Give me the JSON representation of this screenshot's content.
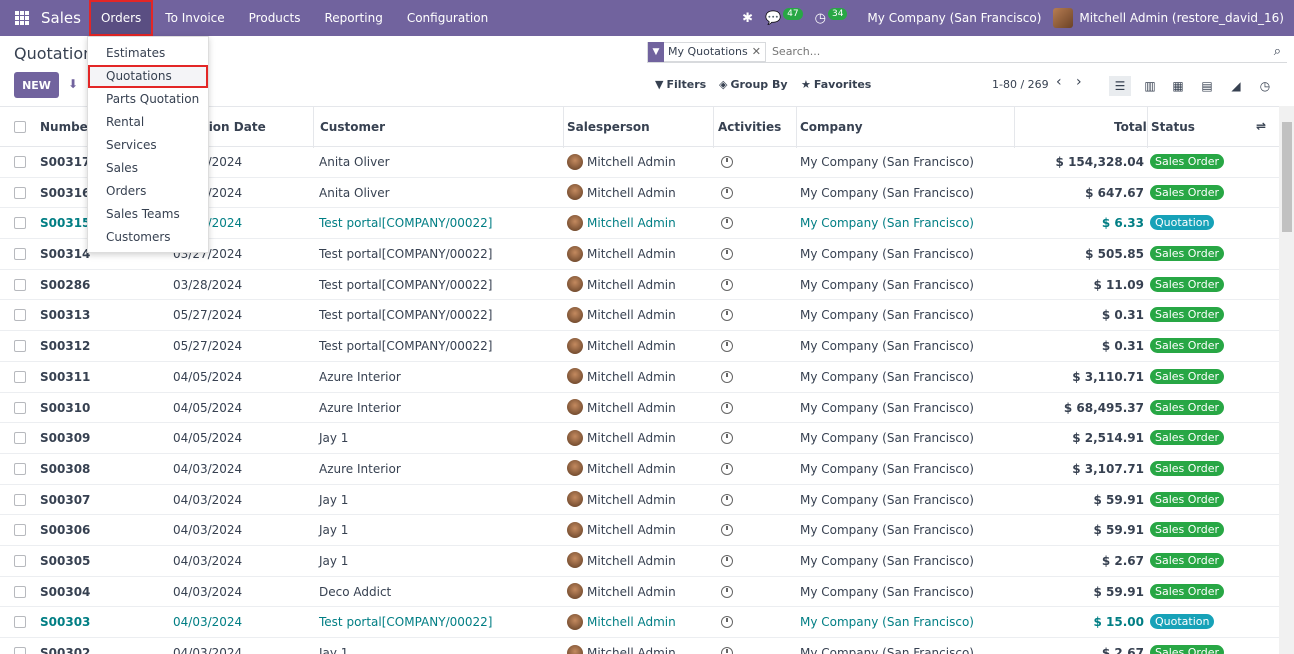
{
  "navbar": {
    "brand": "Sales",
    "menu": [
      "Orders",
      "To Invoice",
      "Products",
      "Reporting",
      "Configuration"
    ],
    "messages_count": "47",
    "activities_count": "34",
    "company": "My Company (San Francisco)",
    "user": "Mitchell Admin (restore_david_16)"
  },
  "dropdown": {
    "items": [
      "Estimates",
      "Quotations",
      "Parts Quotation",
      "Rental",
      "Services",
      "Sales",
      "Orders",
      "Sales Teams",
      "Customers"
    ]
  },
  "control": {
    "title": "Quotations",
    "new_label": "NEW",
    "facet": "My Quotations",
    "search_placeholder": "Search...",
    "filters": "Filters",
    "group_by": "Group By",
    "favorites": "Favorites",
    "pager": "1-80 / 269"
  },
  "table": {
    "headers": {
      "number": "Number",
      "date": "Creation Date",
      "customer": "Customer",
      "salesperson": "Salesperson",
      "activities": "Activities",
      "company": "Company",
      "total": "Total",
      "status": "Status"
    },
    "rows": [
      {
        "number": "S00317",
        "date": "03/27/2024",
        "customer": "Anita Oliver",
        "salesperson": "Mitchell Admin",
        "company": "My Company (San Francisco)",
        "total": "$ 154,328.04",
        "status": "Sales Order",
        "quote": false
      },
      {
        "number": "S00316",
        "date": "03/27/2024",
        "customer": "Anita Oliver",
        "salesperson": "Mitchell Admin",
        "company": "My Company (San Francisco)",
        "total": "$ 647.67",
        "status": "Sales Order",
        "quote": false
      },
      {
        "number": "S00315",
        "date": "03/27/2024",
        "customer": "Test portal[COMPANY/00022]",
        "salesperson": "Mitchell Admin",
        "company": "My Company (San Francisco)",
        "total": "$ 6.33",
        "status": "Quotation",
        "quote": true
      },
      {
        "number": "S00314",
        "date": "03/27/2024",
        "customer": "Test portal[COMPANY/00022]",
        "salesperson": "Mitchell Admin",
        "company": "My Company (San Francisco)",
        "total": "$ 505.85",
        "status": "Sales Order",
        "quote": false
      },
      {
        "number": "S00286",
        "date": "03/28/2024",
        "customer": "Test portal[COMPANY/00022]",
        "salesperson": "Mitchell Admin",
        "company": "My Company (San Francisco)",
        "total": "$ 11.09",
        "status": "Sales Order",
        "quote": false
      },
      {
        "number": "S00313",
        "date": "05/27/2024",
        "customer": "Test portal[COMPANY/00022]",
        "salesperson": "Mitchell Admin",
        "company": "My Company (San Francisco)",
        "total": "$ 0.31",
        "status": "Sales Order",
        "quote": false
      },
      {
        "number": "S00312",
        "date": "05/27/2024",
        "customer": "Test portal[COMPANY/00022]",
        "salesperson": "Mitchell Admin",
        "company": "My Company (San Francisco)",
        "total": "$ 0.31",
        "status": "Sales Order",
        "quote": false
      },
      {
        "number": "S00311",
        "date": "04/05/2024",
        "customer": "Azure Interior",
        "salesperson": "Mitchell Admin",
        "company": "My Company (San Francisco)",
        "total": "$ 3,110.71",
        "status": "Sales Order",
        "quote": false
      },
      {
        "number": "S00310",
        "date": "04/05/2024",
        "customer": "Azure Interior",
        "salesperson": "Mitchell Admin",
        "company": "My Company (San Francisco)",
        "total": "$ 68,495.37",
        "status": "Sales Order",
        "quote": false
      },
      {
        "number": "S00309",
        "date": "04/05/2024",
        "customer": "Jay 1",
        "salesperson": "Mitchell Admin",
        "company": "My Company (San Francisco)",
        "total": "$ 2,514.91",
        "status": "Sales Order",
        "quote": false
      },
      {
        "number": "S00308",
        "date": "04/03/2024",
        "customer": "Azure Interior",
        "salesperson": "Mitchell Admin",
        "company": "My Company (San Francisco)",
        "total": "$ 3,107.71",
        "status": "Sales Order",
        "quote": false
      },
      {
        "number": "S00307",
        "date": "04/03/2024",
        "customer": "Jay 1",
        "salesperson": "Mitchell Admin",
        "company": "My Company (San Francisco)",
        "total": "$ 59.91",
        "status": "Sales Order",
        "quote": false
      },
      {
        "number": "S00306",
        "date": "04/03/2024",
        "customer": "Jay 1",
        "salesperson": "Mitchell Admin",
        "company": "My Company (San Francisco)",
        "total": "$ 59.91",
        "status": "Sales Order",
        "quote": false
      },
      {
        "number": "S00305",
        "date": "04/03/2024",
        "customer": "Jay 1",
        "salesperson": "Mitchell Admin",
        "company": "My Company (San Francisco)",
        "total": "$ 2.67",
        "status": "Sales Order",
        "quote": false
      },
      {
        "number": "S00304",
        "date": "04/03/2024",
        "customer": "Deco Addict",
        "salesperson": "Mitchell Admin",
        "company": "My Company (San Francisco)",
        "total": "$ 59.91",
        "status": "Sales Order",
        "quote": false
      },
      {
        "number": "S00303",
        "date": "04/03/2024",
        "customer": "Test portal[COMPANY/00022]",
        "salesperson": "Mitchell Admin",
        "company": "My Company (San Francisco)",
        "total": "$ 15.00",
        "status": "Quotation",
        "quote": true
      },
      {
        "number": "S00302",
        "date": "04/03/2024",
        "customer": "Jay 1",
        "salesperson": "Mitchell Admin",
        "company": "My Company (San Francisco)",
        "total": "$ 2.67",
        "status": "Sales Order",
        "quote": false
      }
    ]
  },
  "colors": {
    "navbar": "#71639e",
    "quotation_link": "#017e84",
    "sales_order_badge": "#28a745",
    "quotation_badge": "#17a2b8",
    "highlight_box": "#e32626"
  },
  "icons": [
    "apps-grid-icon",
    "bug-icon",
    "chat-icon",
    "clock-icon",
    "download-icon",
    "filter-icon",
    "search-icon",
    "list-view-icon",
    "kanban-view-icon",
    "calendar-view-icon",
    "pivot-view-icon",
    "graph-view-icon",
    "activity-view-icon",
    "optional-columns-icon"
  ]
}
